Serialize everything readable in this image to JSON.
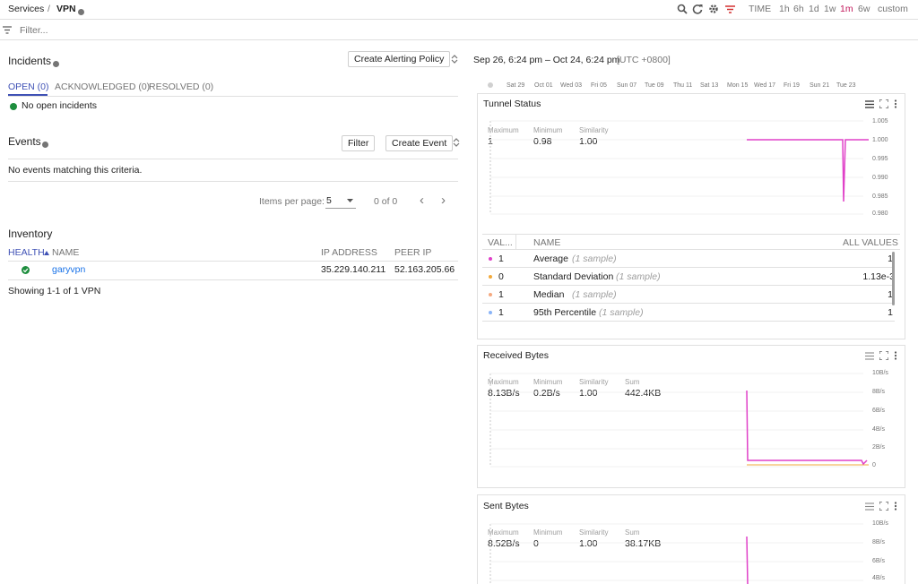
{
  "breadcrumb": {
    "parent": "Services",
    "separator": "/",
    "current": "VPN"
  },
  "time": {
    "label": "TIME",
    "ranges": [
      "1h",
      "6h",
      "1d",
      "1w",
      "1m",
      "6w",
      "custom"
    ],
    "active": "1m"
  },
  "filter": {
    "placeholder": "Filter..."
  },
  "incidents": {
    "title": "Incidents",
    "create_policy_label": "Create Alerting Policy",
    "tabs": [
      "OPEN (0)",
      "ACKNOWLEDGED (0)",
      "RESOLVED (0)"
    ],
    "empty_text": "No open incidents"
  },
  "events": {
    "title": "Events",
    "filter_label": "Filter",
    "create_label": "Create Event",
    "empty_text": "No events matching this criteria.",
    "items_per_page_label": "Items per page:",
    "items_per_page": "5",
    "range_text": "0 of 0",
    "prev": "‹",
    "next": "›"
  },
  "inventory": {
    "title": "Inventory",
    "headers": {
      "health": "HEALTH",
      "name": "NAME",
      "ip": "IP ADDRESS",
      "peer": "PEER IP"
    },
    "rows": [
      {
        "name": "garyvpn",
        "ip": "35.229.140.211",
        "peer": "52.163.205.66"
      }
    ],
    "footer": "Showing 1-1 of 1 VPN"
  },
  "range": {
    "text": "Sep 26, 6:24 pm – Oct 24, 6:24 pm",
    "tz": "[UTC +0800]"
  },
  "timeline": {
    "labels": [
      "Sat 29",
      "Oct 01",
      "Wed 03",
      "Fri 05",
      "Sun 07",
      "Tue 09",
      "Thu 11",
      "Sat 13",
      "Mon 15",
      "Wed 17",
      "Fri 19",
      "Sun 21",
      "Tue 23"
    ]
  },
  "tunnel": {
    "title": "Tunnel Status",
    "stats": [
      {
        "label": "Maximum",
        "value": "1"
      },
      {
        "label": "Minimum",
        "value": "0.98"
      },
      {
        "label": "Similarity",
        "value": "1.00"
      }
    ],
    "yticks": [
      "1.005",
      "1.000",
      "0.995",
      "0.990",
      "0.985",
      "0.980"
    ],
    "table": {
      "headers": {
        "val": "VAL...",
        "name": "NAME",
        "all": "ALL VALUES"
      },
      "rows": [
        {
          "color": "#e040c8",
          "val": "1",
          "name": "Average",
          "samples": "(1 sample)",
          "all": "1"
        },
        {
          "color": "#f2a93b",
          "val": "0",
          "name": "Standard Deviation",
          "samples": "(1 sample)",
          "all": "1.13e-3"
        },
        {
          "color": "#f5a97f",
          "val": "1",
          "name": "Median",
          "samples": "(1 sample)",
          "all": "1"
        },
        {
          "color": "#8ab4f8",
          "val": "1",
          "name": "95th Percentile",
          "samples": "(1 sample)",
          "all": "1"
        }
      ]
    }
  },
  "received": {
    "title": "Received Bytes",
    "stats": [
      {
        "label": "Maximum",
        "value": "8.13B/s"
      },
      {
        "label": "Minimum",
        "value": "0.2B/s"
      },
      {
        "label": "Similarity",
        "value": "1.00"
      },
      {
        "label": "Sum",
        "value": "442.4KB"
      }
    ],
    "yticks": [
      "10B/s",
      "8B/s",
      "6B/s",
      "4B/s",
      "2B/s",
      "0"
    ]
  },
  "sent": {
    "title": "Sent Bytes",
    "stats": [
      {
        "label": "Maximum",
        "value": "8.52B/s"
      },
      {
        "label": "Minimum",
        "value": "0"
      },
      {
        "label": "Similarity",
        "value": "1.00"
      },
      {
        "label": "Sum",
        "value": "38.17KB"
      }
    ],
    "yticks": [
      "10B/s",
      "8B/s",
      "6B/s",
      "4B/s"
    ]
  },
  "colors": {
    "accent": "#3f51b5",
    "link": "#1a73e8",
    "active_time": "#c2185b",
    "ok": "#1e8e3e",
    "series": "#e040c8"
  }
}
